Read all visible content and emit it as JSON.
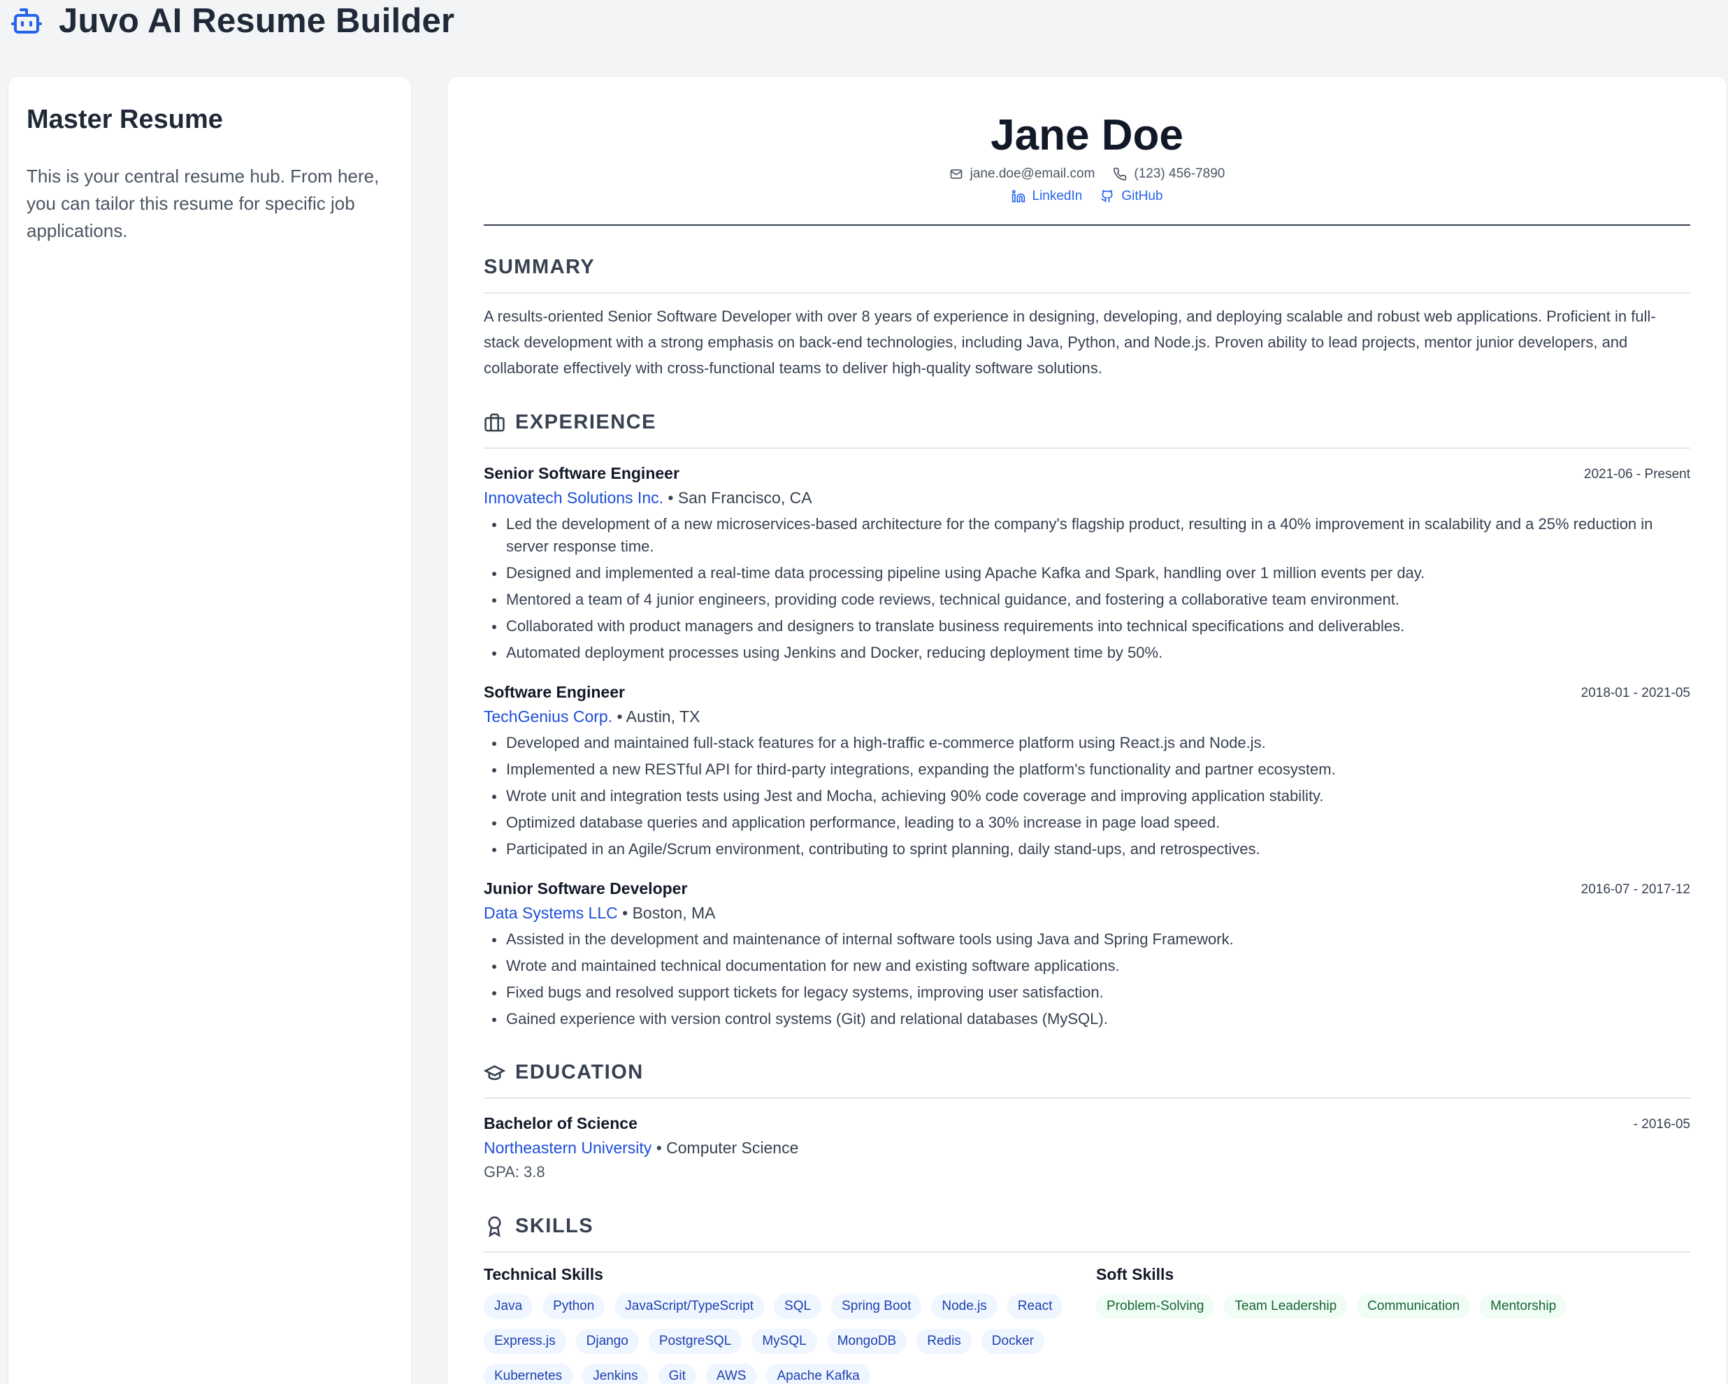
{
  "app": {
    "title": "Juvo AI Resume Builder",
    "logo_icon": "robot-icon",
    "accent": "#2563eb"
  },
  "sidebar": {
    "title": "Master Resume",
    "description": "This is your central resume hub. From here, you can tailor this resume for specific job applications."
  },
  "resume": {
    "name": "Jane Doe",
    "email": "jane.doe@email.com",
    "phone": "(123) 456-7890",
    "linkedin": "LinkedIn",
    "github": "GitHub",
    "sections": {
      "summary": "SUMMARY",
      "experience": "EXPERIENCE",
      "education": "EDUCATION",
      "skills": "SKILLS"
    },
    "summary": "A results-oriented Senior Software Developer with over 8 years of experience in designing, developing, and deploying scalable and robust web applications. Proficient in full-stack development with a strong emphasis on back-end technologies, including Java, Python, and Node.js. Proven ability to lead projects, mentor junior developers, and collaborate effectively with cross-functional teams to deliver high-quality software solutions.",
    "experience": [
      {
        "title": "Senior Software Engineer",
        "dates": "2021-06 - Present",
        "company": "Innovatech Solutions Inc.",
        "location": "San Francisco, CA",
        "bullets": [
          "Led the development of a new microservices-based architecture for the company's flagship product, resulting in a 40% improvement in scalability and a 25% reduction in server response time.",
          "Designed and implemented a real-time data processing pipeline using Apache Kafka and Spark, handling over 1 million events per day.",
          "Mentored a team of 4 junior engineers, providing code reviews, technical guidance, and fostering a collaborative team environment.",
          "Collaborated with product managers and designers to translate business requirements into technical specifications and deliverables.",
          "Automated deployment processes using Jenkins and Docker, reducing deployment time by 50%."
        ]
      },
      {
        "title": "Software Engineer",
        "dates": "2018-01 - 2021-05",
        "company": "TechGenius Corp.",
        "location": "Austin, TX",
        "bullets": [
          "Developed and maintained full-stack features for a high-traffic e-commerce platform using React.js and Node.js.",
          "Implemented a new RESTful API for third-party integrations, expanding the platform's functionality and partner ecosystem.",
          "Wrote unit and integration tests using Jest and Mocha, achieving 90% code coverage and improving application stability.",
          "Optimized database queries and application performance, leading to a 30% increase in page load speed.",
          "Participated in an Agile/Scrum environment, contributing to sprint planning, daily stand-ups, and retrospectives."
        ]
      },
      {
        "title": "Junior Software Developer",
        "dates": "2016-07 - 2017-12",
        "company": "Data Systems LLC",
        "location": "Boston, MA",
        "bullets": [
          "Assisted in the development and maintenance of internal software tools using Java and Spring Framework.",
          "Wrote and maintained technical documentation for new and existing software applications.",
          "Fixed bugs and resolved support tickets for legacy systems, improving user satisfaction.",
          "Gained experience with version control systems (Git) and relational databases (MySQL)."
        ]
      }
    ],
    "education": {
      "degree": "Bachelor of Science",
      "dates": "- 2016-05",
      "school": "Northeastern University",
      "field": "Computer Science",
      "gpa": "GPA: 3.8"
    },
    "skills": {
      "technical_title": "Technical Skills",
      "technical": [
        "Java",
        "Python",
        "JavaScript/TypeScript",
        "SQL",
        "Spring Boot",
        "Node.js",
        "React",
        "Express.js",
        "Django",
        "PostgreSQL",
        "MySQL",
        "MongoDB",
        "Redis",
        "Docker",
        "Kubernetes",
        "Jenkins",
        "Git",
        "AWS",
        "Apache Kafka"
      ],
      "soft_title": "Soft Skills",
      "soft": [
        "Problem-Solving",
        "Team Leadership",
        "Communication",
        "Mentorship"
      ]
    }
  }
}
